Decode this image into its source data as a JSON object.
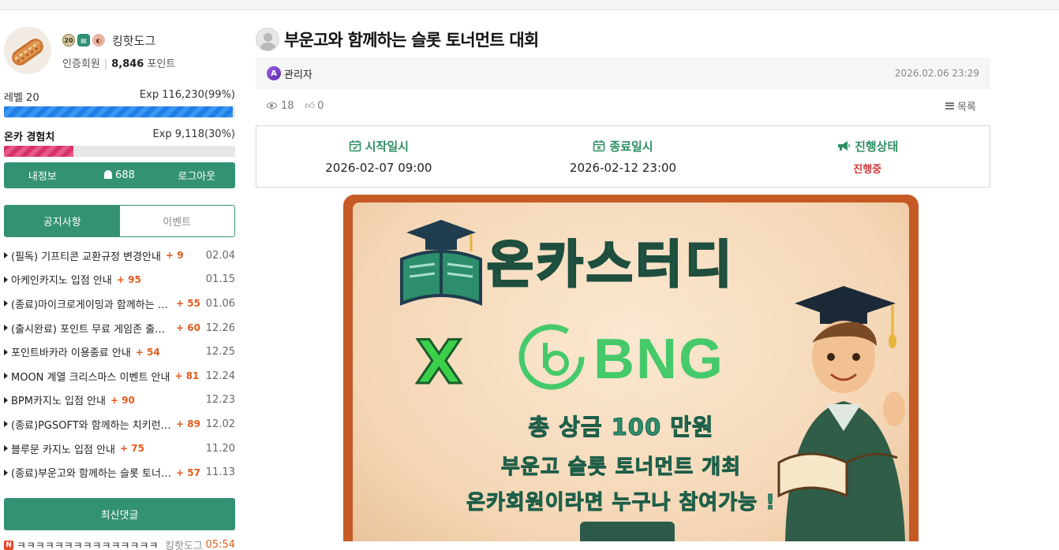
{
  "profile": {
    "nickname": "킹핫도그",
    "level_badge": "20",
    "member_type": "인증회원",
    "points_value": "8,846",
    "points_unit": "포인트"
  },
  "stats": {
    "level_label": "레벨 20",
    "level_exp": "Exp 116,230(99%)",
    "level_progress_pct": 99,
    "onca_label": "온카 경험치",
    "onca_exp": "Exp 9,118(30%)",
    "onca_progress_pct": 30
  },
  "actions": {
    "myinfo": "내정보",
    "notifications": "688",
    "logout": "로그아웃"
  },
  "tabs": [
    {
      "label": "공지사항",
      "active": true
    },
    {
      "label": "이벤트",
      "active": false
    }
  ],
  "notices": [
    {
      "title": "(필독) 기프티콘 교환규정 변경안내",
      "count": "+ 9",
      "date": "02.04"
    },
    {
      "title": "아케인카지노 입점 안내",
      "count": "+ 95",
      "date": "01.15"
    },
    {
      "title": "(종료)마이크로게이밍과 함께하는 슬롯 토너먼트",
      "count": "+ 55",
      "date": "01.06"
    },
    {
      "title": "(출시완료) 포인트 무료 게임존 출시안내",
      "count": "+ 60",
      "date": "12.26"
    },
    {
      "title": "포인트바카라 이용종료 안내",
      "count": "+ 54",
      "date": "12.25"
    },
    {
      "title": "MOON 계열 크리스마스 이벤트 안내",
      "count": "+ 81",
      "date": "12.24"
    },
    {
      "title": "BPM카지노 입점 안내",
      "count": "+ 90",
      "date": "12.23"
    },
    {
      "title": "(종료)PGSOFT와 함께하는 치키런 이벤트",
      "count": "+ 89",
      "date": "12.02"
    },
    {
      "title": "블루문 카지노 입점 안내",
      "count": "+ 75",
      "date": "11.20"
    },
    {
      "title": "(종료)부운고와 함께하는 슬롯 토너먼트",
      "count": "+ 57",
      "date": "11.13"
    }
  ],
  "recent_comments": {
    "button": "최신댓글",
    "items": [
      {
        "badge": "N",
        "text": "ㅋㅋㅋㅋㅋㅋㅋㅋㅋㅋㅋㅋㅋㅋㅋㅋ",
        "user": "킹핫도그",
        "time": "05:54"
      }
    ]
  },
  "post": {
    "title": "부운고와 함께하는 슬롯 토너먼트 대회",
    "author_badge": "A",
    "author": "관리자",
    "datetime": "2026.02.06 23:29",
    "views": "18",
    "likes": "0",
    "list_button": "목록"
  },
  "event": {
    "start_label": "시작일시",
    "start_value": "2026-02-07 09:00",
    "end_label": "종료일시",
    "end_value": "2026-02-12 23:00",
    "status_label": "진행상태",
    "status_value": "진행중"
  },
  "banner": {
    "logo_text": "온카스터디",
    "x_text": "X",
    "partner_text": "BNG",
    "line1": "총 상금 100 만원",
    "line2": "부운고 슬롯 토너먼트 개최",
    "line3": "온카회원이라면 누구나 참여가능 !"
  },
  "colors": {
    "accent_green": "#339273",
    "status_red": "#d23a3a",
    "count_orange": "#e25b1c"
  }
}
